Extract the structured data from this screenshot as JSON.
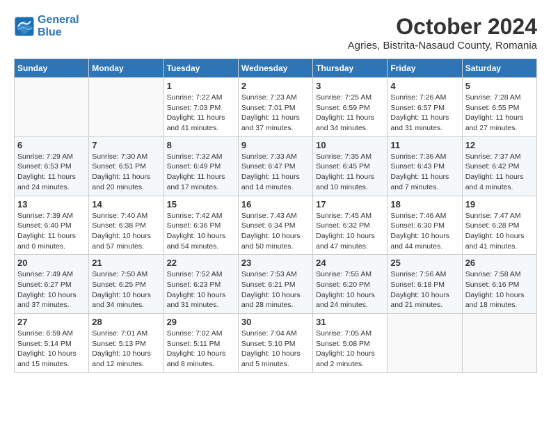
{
  "logo": {
    "line1": "General",
    "line2": "Blue"
  },
  "title": "October 2024",
  "subtitle": "Agries, Bistrita-Nasaud County, Romania",
  "weekdays": [
    "Sunday",
    "Monday",
    "Tuesday",
    "Wednesday",
    "Thursday",
    "Friday",
    "Saturday"
  ],
  "weeks": [
    [
      {
        "day": "",
        "info": ""
      },
      {
        "day": "",
        "info": ""
      },
      {
        "day": "1",
        "info": "Sunrise: 7:22 AM\nSunset: 7:03 PM\nDaylight: 11 hours and 41 minutes."
      },
      {
        "day": "2",
        "info": "Sunrise: 7:23 AM\nSunset: 7:01 PM\nDaylight: 11 hours and 37 minutes."
      },
      {
        "day": "3",
        "info": "Sunrise: 7:25 AM\nSunset: 6:59 PM\nDaylight: 11 hours and 34 minutes."
      },
      {
        "day": "4",
        "info": "Sunrise: 7:26 AM\nSunset: 6:57 PM\nDaylight: 11 hours and 31 minutes."
      },
      {
        "day": "5",
        "info": "Sunrise: 7:28 AM\nSunset: 6:55 PM\nDaylight: 11 hours and 27 minutes."
      }
    ],
    [
      {
        "day": "6",
        "info": "Sunrise: 7:29 AM\nSunset: 6:53 PM\nDaylight: 11 hours and 24 minutes."
      },
      {
        "day": "7",
        "info": "Sunrise: 7:30 AM\nSunset: 6:51 PM\nDaylight: 11 hours and 20 minutes."
      },
      {
        "day": "8",
        "info": "Sunrise: 7:32 AM\nSunset: 6:49 PM\nDaylight: 11 hours and 17 minutes."
      },
      {
        "day": "9",
        "info": "Sunrise: 7:33 AM\nSunset: 6:47 PM\nDaylight: 11 hours and 14 minutes."
      },
      {
        "day": "10",
        "info": "Sunrise: 7:35 AM\nSunset: 6:45 PM\nDaylight: 11 hours and 10 minutes."
      },
      {
        "day": "11",
        "info": "Sunrise: 7:36 AM\nSunset: 6:43 PM\nDaylight: 11 hours and 7 minutes."
      },
      {
        "day": "12",
        "info": "Sunrise: 7:37 AM\nSunset: 6:42 PM\nDaylight: 11 hours and 4 minutes."
      }
    ],
    [
      {
        "day": "13",
        "info": "Sunrise: 7:39 AM\nSunset: 6:40 PM\nDaylight: 11 hours and 0 minutes."
      },
      {
        "day": "14",
        "info": "Sunrise: 7:40 AM\nSunset: 6:38 PM\nDaylight: 10 hours and 57 minutes."
      },
      {
        "day": "15",
        "info": "Sunrise: 7:42 AM\nSunset: 6:36 PM\nDaylight: 10 hours and 54 minutes."
      },
      {
        "day": "16",
        "info": "Sunrise: 7:43 AM\nSunset: 6:34 PM\nDaylight: 10 hours and 50 minutes."
      },
      {
        "day": "17",
        "info": "Sunrise: 7:45 AM\nSunset: 6:32 PM\nDaylight: 10 hours and 47 minutes."
      },
      {
        "day": "18",
        "info": "Sunrise: 7:46 AM\nSunset: 6:30 PM\nDaylight: 10 hours and 44 minutes."
      },
      {
        "day": "19",
        "info": "Sunrise: 7:47 AM\nSunset: 6:28 PM\nDaylight: 10 hours and 41 minutes."
      }
    ],
    [
      {
        "day": "20",
        "info": "Sunrise: 7:49 AM\nSunset: 6:27 PM\nDaylight: 10 hours and 37 minutes."
      },
      {
        "day": "21",
        "info": "Sunrise: 7:50 AM\nSunset: 6:25 PM\nDaylight: 10 hours and 34 minutes."
      },
      {
        "day": "22",
        "info": "Sunrise: 7:52 AM\nSunset: 6:23 PM\nDaylight: 10 hours and 31 minutes."
      },
      {
        "day": "23",
        "info": "Sunrise: 7:53 AM\nSunset: 6:21 PM\nDaylight: 10 hours and 28 minutes."
      },
      {
        "day": "24",
        "info": "Sunrise: 7:55 AM\nSunset: 6:20 PM\nDaylight: 10 hours and 24 minutes."
      },
      {
        "day": "25",
        "info": "Sunrise: 7:56 AM\nSunset: 6:18 PM\nDaylight: 10 hours and 21 minutes."
      },
      {
        "day": "26",
        "info": "Sunrise: 7:58 AM\nSunset: 6:16 PM\nDaylight: 10 hours and 18 minutes."
      }
    ],
    [
      {
        "day": "27",
        "info": "Sunrise: 6:59 AM\nSunset: 5:14 PM\nDaylight: 10 hours and 15 minutes."
      },
      {
        "day": "28",
        "info": "Sunrise: 7:01 AM\nSunset: 5:13 PM\nDaylight: 10 hours and 12 minutes."
      },
      {
        "day": "29",
        "info": "Sunrise: 7:02 AM\nSunset: 5:11 PM\nDaylight: 10 hours and 8 minutes."
      },
      {
        "day": "30",
        "info": "Sunrise: 7:04 AM\nSunset: 5:10 PM\nDaylight: 10 hours and 5 minutes."
      },
      {
        "day": "31",
        "info": "Sunrise: 7:05 AM\nSunset: 5:08 PM\nDaylight: 10 hours and 2 minutes."
      },
      {
        "day": "",
        "info": ""
      },
      {
        "day": "",
        "info": ""
      }
    ]
  ]
}
